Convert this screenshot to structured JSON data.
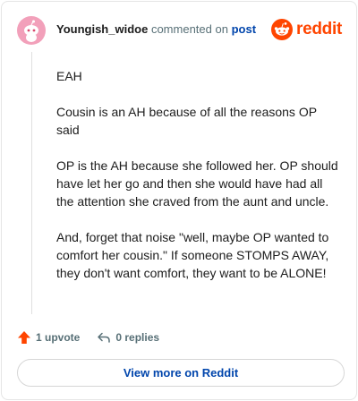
{
  "header": {
    "author": "Youngish_widoe",
    "action_text": "commented on",
    "post_link": "post",
    "brand": "reddit"
  },
  "comment": {
    "paragraphs": [
      "EAH",
      "Cousin is an AH because of all the reasons OP said",
      "OP is the AH because she followed her. OP should have let her go and then she would have had all the attention she craved from the aunt and uncle.",
      "And, forget that noise \"well, maybe OP wanted to comfort her cousin.\" If someone STOMPS AWAY, they don't want comfort, they want to be ALONE!"
    ]
  },
  "actions": {
    "upvote_label": "1 upvote",
    "replies_label": "0 replies"
  },
  "footer": {
    "view_more_label": "View more on Reddit"
  },
  "colors": {
    "brand_orange": "#ff4500",
    "link_blue": "#0045ac",
    "avatar_pink": "#f2a0ba",
    "meta_gray": "#576f76"
  },
  "icons": {
    "avatar": "snoo-avatar-icon",
    "logo": "reddit-snoo-logo-icon",
    "upvote": "upvote-arrow-icon",
    "reply": "reply-arrow-icon"
  }
}
